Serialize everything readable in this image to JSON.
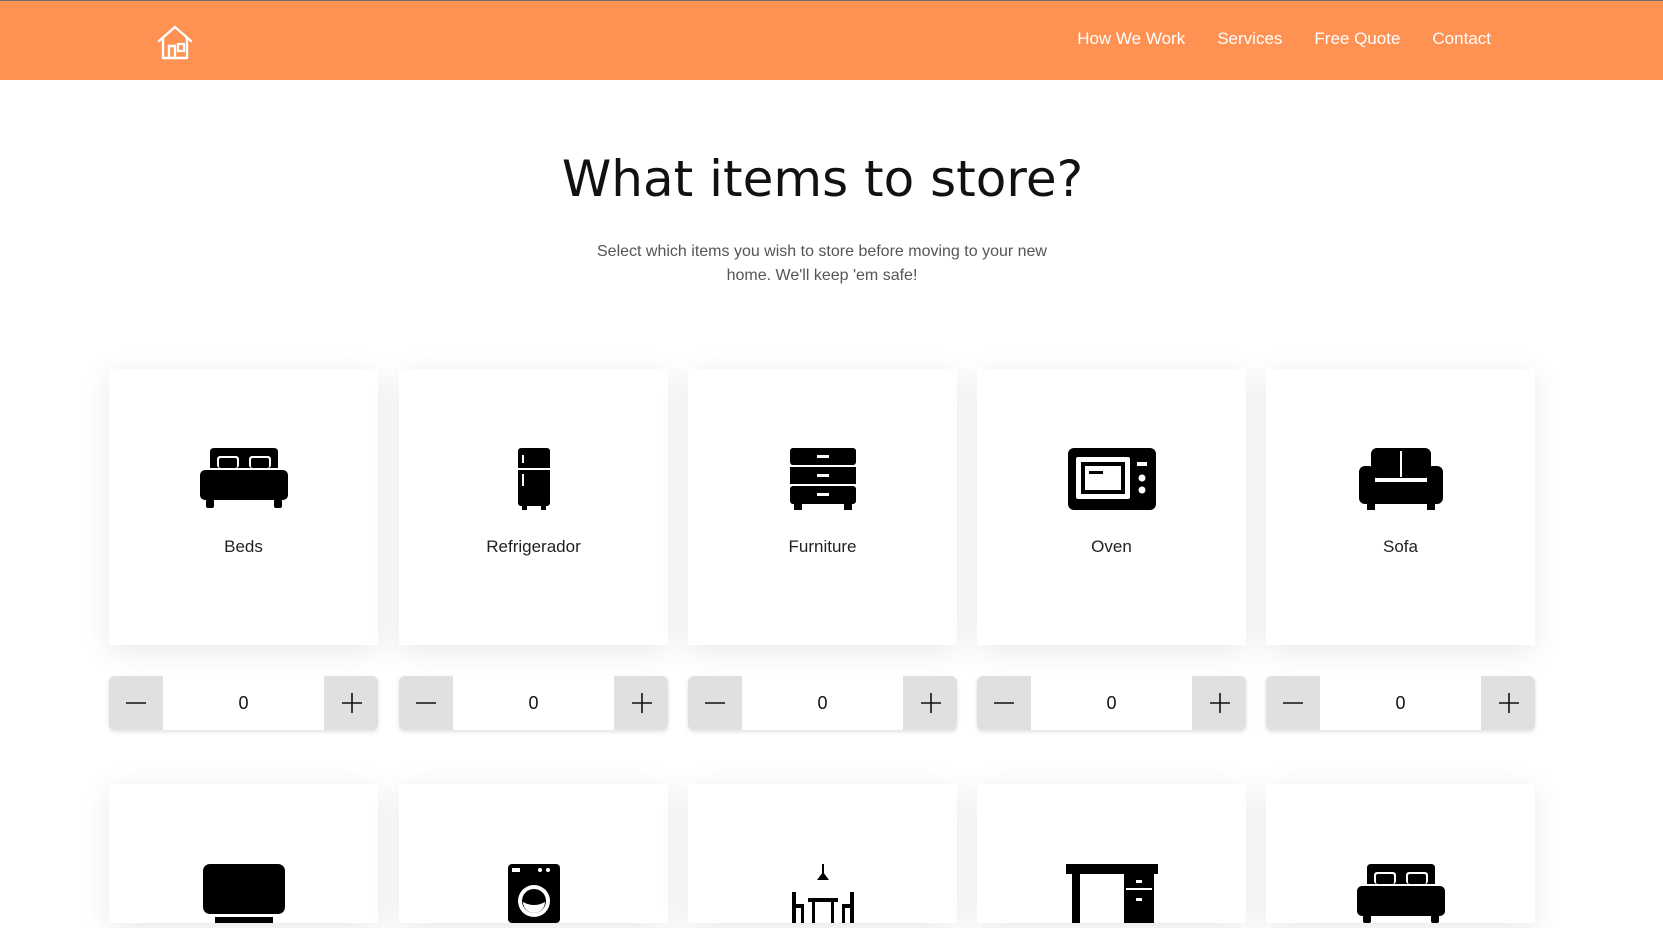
{
  "header": {
    "logo_icon": "house-icon",
    "bg_color": "#ff9152",
    "nav": [
      {
        "label": "How We Work"
      },
      {
        "label": "Services"
      },
      {
        "label": "Free Quote"
      },
      {
        "label": "Contact"
      }
    ]
  },
  "hero": {
    "title": "What items to store?",
    "subtitle": "Select which items you wish to store before moving to your new home. We'll keep 'em safe!"
  },
  "items": [
    {
      "label": "Beds",
      "icon": "bed-icon",
      "count": "0"
    },
    {
      "label": "Refrigerador",
      "icon": "refrigerator-icon",
      "count": "0"
    },
    {
      "label": "Furniture",
      "icon": "dresser-icon",
      "count": "0"
    },
    {
      "label": "Oven",
      "icon": "microwave-oven-icon",
      "count": "0"
    },
    {
      "label": "Sofa",
      "icon": "sofa-icon",
      "count": "0"
    }
  ],
  "items_row2": [
    {
      "icon": "tv-icon"
    },
    {
      "icon": "washing-machine-icon"
    },
    {
      "icon": "dining-table-icon"
    },
    {
      "icon": "desk-icon"
    },
    {
      "icon": "bed-icon"
    }
  ]
}
